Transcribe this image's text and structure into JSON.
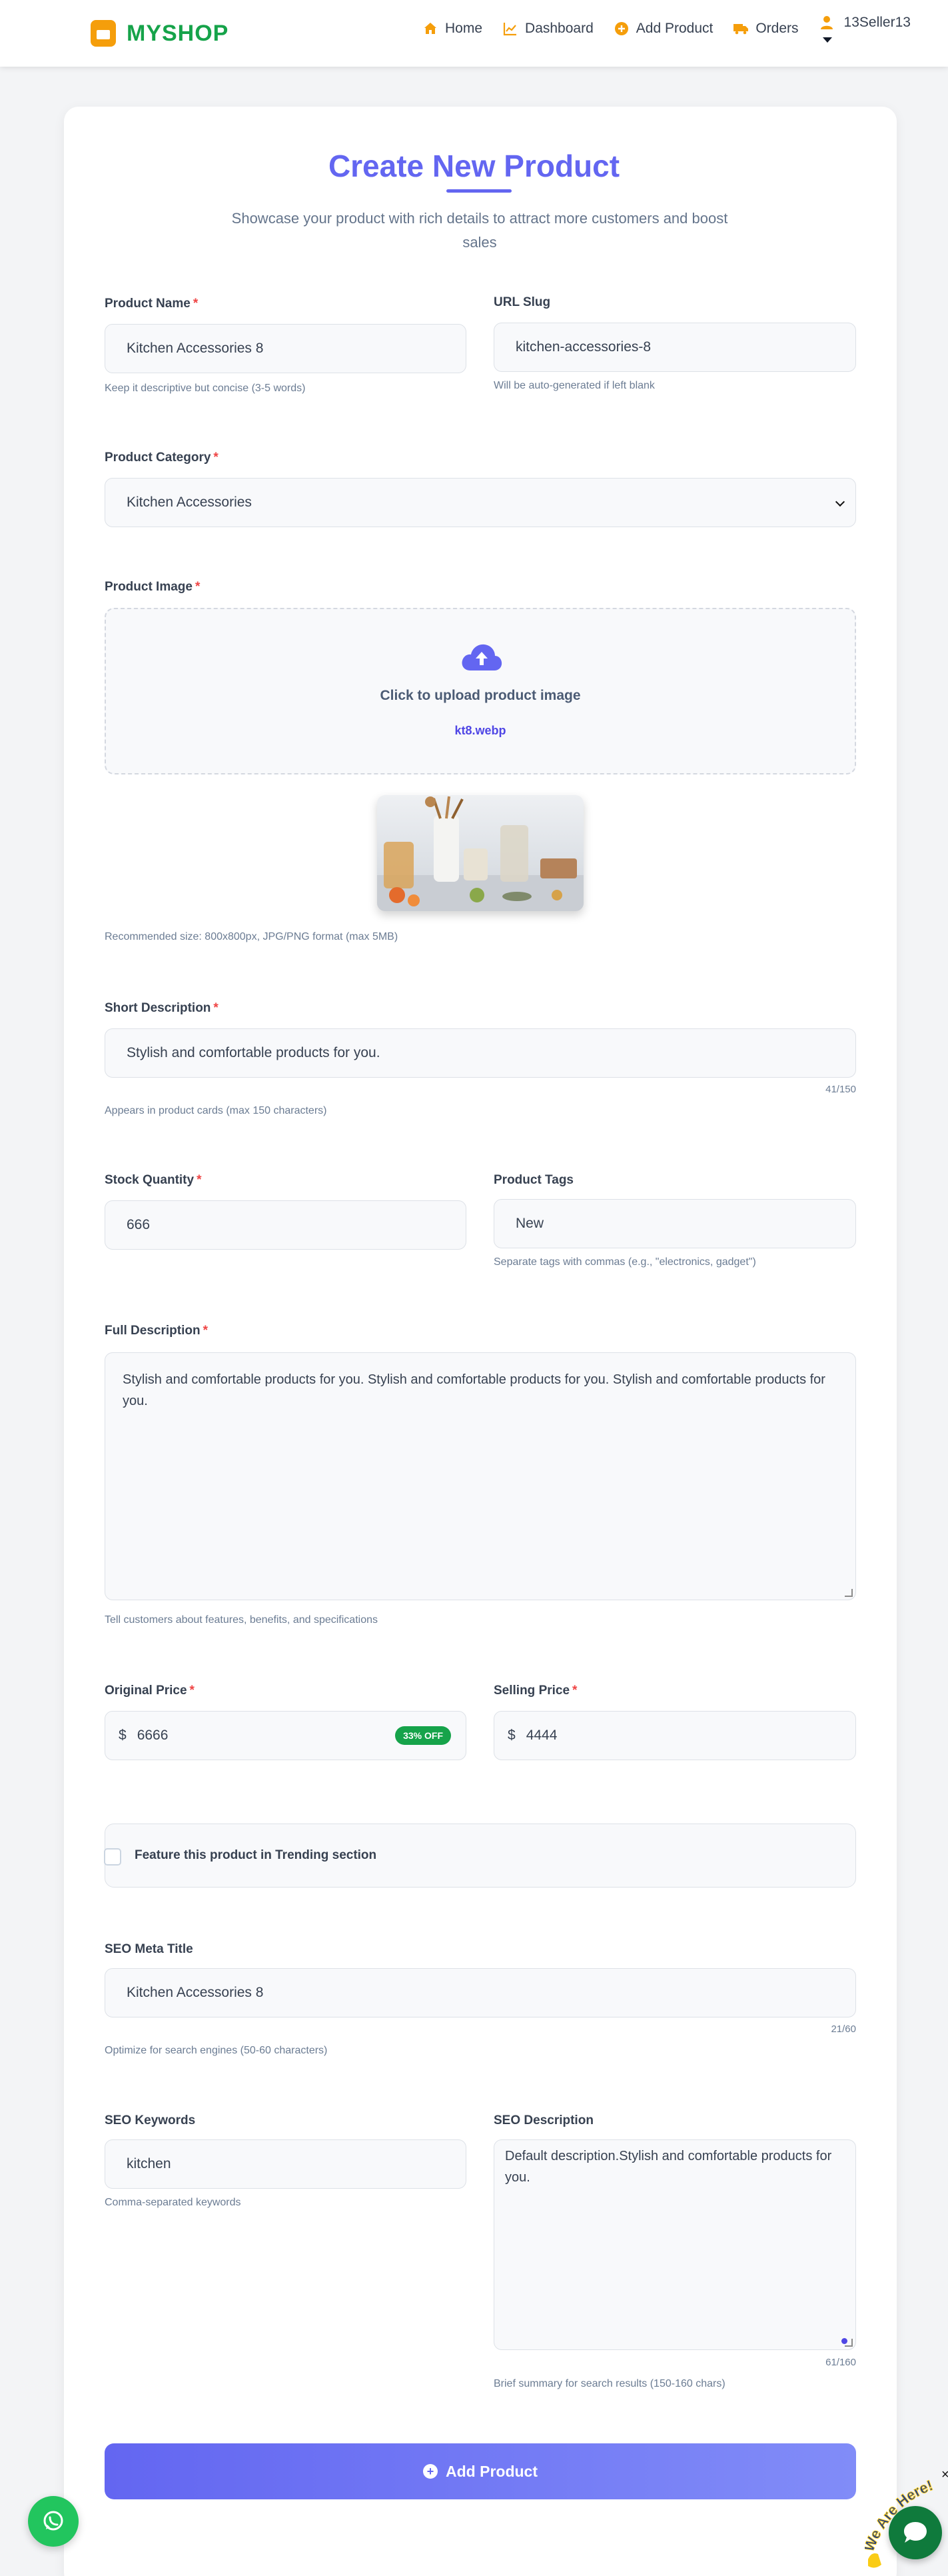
{
  "brand": {
    "name": "MYSHOP"
  },
  "nav": {
    "home": "Home",
    "dashboard": "Dashboard",
    "add_product": "Add Product",
    "orders": "Orders",
    "user": "13Seller13"
  },
  "header": {
    "title": "Create New Product",
    "subtitle": "Showcase your product with rich details to attract more customers and boost sales"
  },
  "form": {
    "product_name": {
      "label": "Product Name",
      "value": "Kitchen Accessories 8",
      "hint": "Keep it descriptive but concise (3-5 words)"
    },
    "url_slug": {
      "label": "URL Slug",
      "value": "kitchen-accessories-8",
      "hint": "Will be auto-generated if left blank"
    },
    "category": {
      "label": "Product Category",
      "value": "Kitchen Accessories"
    },
    "image": {
      "label": "Product Image",
      "upload_text": "Click to upload product image",
      "file_name": "kt8.webp",
      "hint": "Recommended size: 800x800px, JPG/PNG format (max 5MB)"
    },
    "short_description": {
      "label": "Short Description",
      "value": "Stylish and comfortable products for you.",
      "count": "41/150",
      "hint": "Appears in product cards (max 150 characters)"
    },
    "stock": {
      "label": "Stock Quantity",
      "value": "666"
    },
    "tags": {
      "label": "Product Tags",
      "value": "New",
      "hint": "Separate tags with commas (e.g., \"electronics, gadget\")"
    },
    "full_description": {
      "label": "Full Description",
      "value": "Stylish and comfortable products for you. Stylish and comfortable products for you. Stylish and comfortable products for you.",
      "hint": "Tell customers about features, benefits, and specifications"
    },
    "original_price": {
      "label": "Original Price",
      "currency": "$",
      "value": "6666",
      "discount": "33% OFF"
    },
    "selling_price": {
      "label": "Selling Price",
      "currency": "$",
      "value": "4444"
    },
    "trending": {
      "label": "Feature this product in Trending section",
      "checked": false
    },
    "seo_title": {
      "label": "SEO Meta Title",
      "value": "Kitchen Accessories 8",
      "count": "21/60",
      "hint": "Optimize for search engines (50-60 characters)"
    },
    "seo_keywords": {
      "label": "SEO Keywords",
      "value": "kitchen",
      "hint": "Comma-separated keywords"
    },
    "seo_description": {
      "label": "SEO Description",
      "value": "Default description.Stylish and comfortable products for you.",
      "count": "61/160",
      "hint": "Brief summary for search results (150-160 chars)"
    },
    "submit_label": "Add Product",
    "required_mark": "*"
  },
  "widgets": {
    "chat_tag": "We Are Here!"
  },
  "colors": {
    "accent": "#6366f1",
    "brand": "#16a34a",
    "icon": "#f59e0b",
    "required": "#ef4444"
  }
}
